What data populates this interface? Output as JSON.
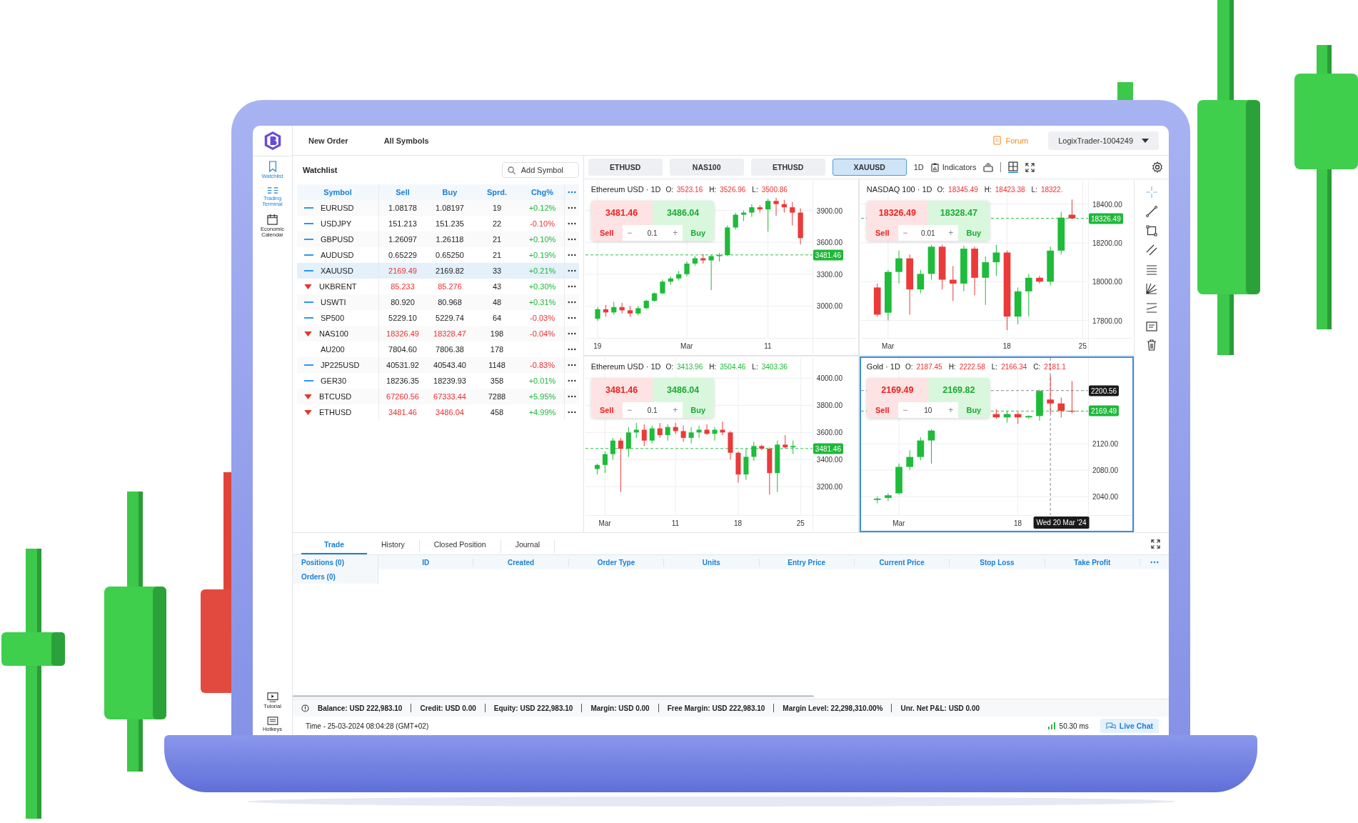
{
  "sidebar": {
    "items": [
      {
        "label": "Watchlist",
        "selected": true
      },
      {
        "label": "Trading Terminal",
        "selected": true
      },
      {
        "label": "Economic Calendar",
        "selected": false
      }
    ],
    "bottom_items": [
      {
        "label": "Tutorial"
      },
      {
        "label": "Hotkeys"
      }
    ]
  },
  "top_bar": {
    "menu": [
      "New Order",
      "All Symbols"
    ],
    "forum": "Forum",
    "account": "LogixTrader-1004249"
  },
  "watchlist": {
    "title": "Watchlist",
    "search": {
      "placeholder": "Add Symbol"
    },
    "columns": [
      "Symbol",
      "Sell",
      "Buy",
      "Sprd.",
      "Chg%"
    ],
    "rows": [
      {
        "kind": "dash",
        "symbol": "EURUSD",
        "sell": "1.08178",
        "buy": "1.08197",
        "sell_falling": false,
        "buy_falling": false,
        "spread": "19",
        "change": "+0.12%",
        "change_positive": true,
        "selected": false
      },
      {
        "kind": "dash",
        "symbol": "USDJPY",
        "sell": "151.213",
        "buy": "151.235",
        "sell_falling": false,
        "buy_falling": false,
        "spread": "22",
        "change": "-0.10%",
        "change_positive": false,
        "selected": false
      },
      {
        "kind": "dash",
        "symbol": "GBPUSD",
        "sell": "1.26097",
        "buy": "1.26118",
        "sell_falling": false,
        "buy_falling": false,
        "spread": "21",
        "change": "+0.10%",
        "change_positive": true,
        "selected": false
      },
      {
        "kind": "dash",
        "symbol": "AUDUSD",
        "sell": "0.65229",
        "buy": "0.65250",
        "sell_falling": false,
        "buy_falling": false,
        "spread": "21",
        "change": "+0.19%",
        "change_positive": true,
        "selected": false
      },
      {
        "kind": "dash",
        "symbol": "XAUUSD",
        "sell": "2169.49",
        "buy": "2169.82",
        "sell_falling": true,
        "buy_falling": false,
        "spread": "33",
        "change": "+0.21%",
        "change_positive": true,
        "selected": true
      },
      {
        "kind": "down",
        "symbol": "UKBRENT",
        "sell": "85.233",
        "buy": "85.276",
        "sell_falling": true,
        "buy_falling": true,
        "spread": "43",
        "change": "+0.30%",
        "change_positive": true,
        "selected": false
      },
      {
        "kind": "dash",
        "symbol": "USWTI",
        "sell": "80.920",
        "buy": "80.968",
        "sell_falling": false,
        "buy_falling": false,
        "spread": "48",
        "change": "+0.31%",
        "change_positive": true,
        "selected": false
      },
      {
        "kind": "dash",
        "symbol": "SP500",
        "sell": "5229.10",
        "buy": "5229.74",
        "sell_falling": false,
        "buy_falling": false,
        "spread": "64",
        "change": "-0.03%",
        "change_positive": false,
        "selected": false
      },
      {
        "kind": "down",
        "symbol": "NAS100",
        "sell": "18326.49",
        "buy": "18328.47",
        "sell_falling": true,
        "buy_falling": true,
        "spread": "198",
        "change": "-0.04%",
        "change_positive": false,
        "selected": false
      },
      {
        "kind": "none",
        "symbol": "AU200",
        "sell": "7804.60",
        "buy": "7806.38",
        "sell_falling": false,
        "buy_falling": false,
        "spread": "178",
        "selected": false
      },
      {
        "kind": "dash",
        "symbol": "JP225USD",
        "sell": "40531.92",
        "buy": "40543.40",
        "sell_falling": false,
        "buy_falling": false,
        "spread": "1148",
        "change": "-0.83%",
        "change_positive": false,
        "selected": false
      },
      {
        "kind": "dash",
        "symbol": "GER30",
        "sell": "18236.35",
        "buy": "18239.93",
        "sell_falling": false,
        "buy_falling": false,
        "spread": "358",
        "change": "+0.01%",
        "change_positive": true,
        "selected": false
      },
      {
        "kind": "down",
        "symbol": "BTCUSD",
        "sell": "67260.56",
        "buy": "67333.44",
        "sell_falling": true,
        "buy_falling": true,
        "spread": "7288",
        "change": "+5.95%",
        "change_positive": true,
        "selected": false
      },
      {
        "kind": "down",
        "symbol": "ETHUSD",
        "sell": "3481.46",
        "buy": "3486.04",
        "sell_falling": true,
        "buy_falling": true,
        "spread": "458",
        "change": "+4.99%",
        "change_positive": true,
        "selected": false
      }
    ]
  },
  "chart_tabs": [
    {
      "label": "ETHUSD",
      "selected": false
    },
    {
      "label": "NAS100",
      "selected": false
    },
    {
      "label": "ETHUSD",
      "selected": false
    },
    {
      "label": "XAUUSD",
      "selected": true
    }
  ],
  "chart_toolbar": {
    "interval": "1D",
    "indicators": "Indicators"
  },
  "charts": [
    {
      "title": "Ethereum USD · 1D",
      "falling": true,
      "ohlc_values": [
        {
          "label": "O:",
          "value": "3523.16"
        },
        {
          "label": "H:",
          "value": "3526.96"
        },
        {
          "label": "L:",
          "value": "3500.86"
        }
      ],
      "sell_price": "3481.46",
      "buy_price": "3486.04",
      "sell_label": "Sell",
      "buy_label": "Buy",
      "minus": "−",
      "plus": "+",
      "quantity": "0.1",
      "selected": false,
      "price_tags": [
        {
          "kind": "bid",
          "text": "3481.46"
        }
      ],
      "chart_data": {
        "type": "candlestick",
        "grid": true,
        "categories": [
          null,
          "19",
          null,
          null,
          null,
          null,
          null,
          null,
          null,
          null,
          null,
          null,
          "Mar",
          null,
          null,
          null,
          null,
          null,
          null,
          null,
          null,
          null,
          "11",
          null,
          null,
          null,
          null,
          null
        ],
        "ohlc": [
          null,
          [
            2880,
            2990,
            2860,
            2970
          ],
          [
            2970,
            3010,
            2900,
            2940
          ],
          [
            2940,
            3040,
            2920,
            2990
          ],
          [
            2990,
            3030,
            2930,
            2960
          ],
          [
            2960,
            3000,
            2900,
            2930
          ],
          [
            2930,
            3000,
            2910,
            2980
          ],
          [
            2980,
            3060,
            2970,
            3050
          ],
          [
            3050,
            3130,
            3040,
            3120
          ],
          [
            3120,
            3250,
            3110,
            3230
          ],
          [
            3230,
            3280,
            3200,
            3260
          ],
          [
            3260,
            3330,
            3240,
            3300
          ],
          [
            3300,
            3420,
            3280,
            3400
          ],
          [
            3400,
            3470,
            3380,
            3450
          ],
          [
            3450,
            3490,
            3400,
            3430
          ],
          [
            3430,
            3480,
            3150,
            3470
          ],
          [
            3470,
            3500,
            3420,
            3480
          ],
          [
            3480,
            3760,
            3470,
            3740
          ],
          [
            3740,
            3880,
            3720,
            3860
          ],
          [
            3860,
            3900,
            3800,
            3880
          ],
          [
            3880,
            3960,
            3840,
            3930
          ],
          [
            3930,
            3950,
            3880,
            3910
          ],
          [
            3910,
            4010,
            3700,
            3990
          ],
          [
            3990,
            4020,
            3850,
            3960
          ],
          [
            3960,
            4000,
            3880,
            3930
          ],
          [
            3930,
            3980,
            3760,
            3880
          ],
          [
            3880,
            3920,
            3580,
            3640
          ],
          null
        ],
        "ylim": [
          2700,
          4180
        ],
        "yticks": [
          {
            "value": 3900,
            "label": "3900.00"
          },
          {
            "value": 3600,
            "label": "3600.00"
          },
          {
            "value": 3300,
            "label": "3300.00"
          },
          {
            "value": 3000,
            "label": "3000.00"
          }
        ],
        "ref_lines": [
          {
            "axis": "y",
            "value": 3481.46
          }
        ]
      }
    },
    {
      "title": "NASDAQ 100 · 1D",
      "falling": true,
      "ohlc_values": [
        {
          "label": "O:",
          "value": "18345.49"
        },
        {
          "label": "H:",
          "value": "18423.38"
        },
        {
          "label": "L:",
          "value": "18322."
        }
      ],
      "sell_price": "18326.49",
      "buy_price": "18328.47",
      "sell_label": "Sell",
      "buy_label": "Buy",
      "minus": "−",
      "plus": "+",
      "quantity": "0.01",
      "selected": false,
      "price_tags": [
        {
          "kind": "bid",
          "text": "18326.49"
        }
      ],
      "chart_data": {
        "type": "candlestick",
        "grid": true,
        "categories": [
          null,
          null,
          "Mar",
          null,
          null,
          null,
          null,
          null,
          null,
          null,
          null,
          null,
          null,
          "18",
          null,
          null,
          null,
          null,
          null,
          null,
          "25"
        ],
        "ohlc": [
          null,
          [
            17970,
            17990,
            17820,
            17830
          ],
          [
            17840,
            18060,
            17800,
            18050
          ],
          [
            18050,
            18160,
            17990,
            18120
          ],
          [
            18120,
            18140,
            17830,
            17960
          ],
          [
            17960,
            18060,
            17940,
            18040
          ],
          [
            18040,
            18190,
            18010,
            18180
          ],
          [
            18180,
            18190,
            17960,
            18010
          ],
          [
            18010,
            18080,
            17900,
            17990
          ],
          [
            17990,
            18185,
            17950,
            18170
          ],
          [
            18170,
            18180,
            17930,
            18020
          ],
          [
            18020,
            18130,
            17880,
            18100
          ],
          [
            18100,
            18190,
            18030,
            18150
          ],
          [
            18150,
            18160,
            17750,
            17820
          ],
          [
            17820,
            17970,
            17780,
            17950
          ],
          [
            17950,
            18040,
            17820,
            18020
          ],
          [
            18020,
            18030,
            17990,
            18000
          ],
          [
            18000,
            18180,
            17980,
            18160
          ],
          [
            18160,
            18360,
            18140,
            18330
          ],
          [
            18345,
            18423,
            18322,
            18326
          ],
          null
        ],
        "ylim": [
          17710,
          18520
        ],
        "yticks": [
          {
            "value": 18400,
            "label": "18400.00"
          },
          {
            "value": 18200,
            "label": "18200.00"
          },
          {
            "value": 18000,
            "label": "18000.00"
          },
          {
            "value": 17800,
            "label": "17800.00"
          }
        ],
        "ref_lines": [
          {
            "axis": "y",
            "value": 18326.49
          }
        ]
      }
    },
    {
      "title": "Ethereum USD · 1D",
      "falling": false,
      "ohlc_values": [
        {
          "label": "O:",
          "value": "3413.96"
        },
        {
          "label": "H:",
          "value": "3504.46"
        },
        {
          "label": "L:",
          "value": "3403.36"
        }
      ],
      "sell_price": "3481.46",
      "buy_price": "3486.04",
      "sell_label": "Sell",
      "buy_label": "Buy",
      "minus": "−",
      "plus": "+",
      "quantity": "0.1",
      "selected": false,
      "price_tags": [
        {
          "kind": "bid",
          "text": "3481.46"
        }
      ],
      "chart_data": {
        "type": "candlestick",
        "grid": true,
        "categories": [
          null,
          null,
          "Mar",
          null,
          null,
          null,
          null,
          null,
          null,
          null,
          null,
          "11",
          null,
          null,
          null,
          null,
          null,
          null,
          null,
          "18",
          null,
          null,
          null,
          null,
          null,
          null,
          null,
          "25",
          null
        ],
        "ohlc": [
          null,
          [
            3330,
            3370,
            3290,
            3360
          ],
          [
            3360,
            3460,
            3300,
            3440
          ],
          [
            3440,
            3560,
            3400,
            3540
          ],
          [
            3540,
            3560,
            3160,
            3480
          ],
          [
            3480,
            3640,
            3420,
            3600
          ],
          [
            3600,
            3670,
            3560,
            3620
          ],
          [
            3620,
            3660,
            3500,
            3540
          ],
          [
            3540,
            3650,
            3520,
            3630
          ],
          [
            3630,
            3670,
            3560,
            3580
          ],
          [
            3580,
            3660,
            3540,
            3640
          ],
          [
            3640,
            3670,
            3590,
            3610
          ],
          [
            3610,
            3650,
            3530,
            3560
          ],
          [
            3560,
            3640,
            3520,
            3600
          ],
          [
            3600,
            3650,
            3560,
            3620
          ],
          [
            3620,
            3660,
            3580,
            3590
          ],
          [
            3590,
            3640,
            3540,
            3620
          ],
          [
            3620,
            3680,
            3580,
            3600
          ],
          [
            3600,
            3610,
            3400,
            3450
          ],
          [
            3450,
            3460,
            3230,
            3290
          ],
          [
            3290,
            3480,
            3250,
            3420
          ],
          [
            3420,
            3530,
            3390,
            3500
          ],
          [
            3500,
            3510,
            3470,
            3480
          ],
          [
            3480,
            3490,
            3140,
            3300
          ],
          [
            3300,
            3540,
            3160,
            3510
          ],
          [
            3510,
            3580,
            3480,
            3490
          ],
          [
            3490,
            3540,
            3440,
            3500
          ],
          null,
          null
        ],
        "ylim": [
          2990,
          4150
        ],
        "yticks": [
          {
            "value": 4000,
            "label": "4000.00"
          },
          {
            "value": 3800,
            "label": "3800.00"
          },
          {
            "value": 3600,
            "label": "3600.00"
          },
          {
            "value": 3400,
            "label": "3400.00"
          },
          {
            "value": 3200,
            "label": "3200.00"
          }
        ],
        "ref_lines": [
          {
            "axis": "y",
            "value": 3481.46
          }
        ]
      }
    },
    {
      "title": "Gold · 1D",
      "falling": true,
      "ohlc_values": [
        {
          "label": "O:",
          "value": "2187.45"
        },
        {
          "label": "H:",
          "value": "2222.58"
        },
        {
          "label": "L:",
          "value": "2166.34"
        },
        {
          "label": "C:",
          "value": "2181.1"
        }
      ],
      "sell_price": "2169.49",
      "buy_price": "2169.82",
      "sell_label": "Sell",
      "buy_label": "Buy",
      "minus": "−",
      "plus": "+",
      "quantity": "10",
      "selected": true,
      "crosshair_date": "Wed 20 Mar '24",
      "price_tags": [
        {
          "kind": "crosshair",
          "text": "2200.56"
        },
        {
          "kind": "bid",
          "text": "2169.49"
        }
      ],
      "chart_data": {
        "type": "candlestick",
        "grid": true,
        "categories": [
          null,
          null,
          null,
          "Mar",
          null,
          null,
          null,
          null,
          null,
          null,
          null,
          null,
          null,
          null,
          "18",
          null,
          null,
          null,
          null,
          null,
          null
        ],
        "ohlc": [
          null,
          [
            2035,
            2040,
            2030,
            2037
          ],
          [
            2038,
            2045,
            2033,
            2042
          ],
          [
            2045,
            2090,
            2043,
            2085
          ],
          [
            2085,
            2110,
            2080,
            2100
          ],
          [
            2100,
            2130,
            2095,
            2125
          ],
          [
            2125,
            2142,
            2090,
            2140
          ],
          null,
          null,
          null,
          null,
          null,
          [
            2165,
            2172,
            2158,
            2160
          ],
          [
            2160,
            2170,
            2152,
            2165
          ],
          [
            2165,
            2168,
            2150,
            2160
          ],
          [
            2160,
            2163,
            2158,
            2162
          ],
          [
            2162,
            2202,
            2155,
            2200
          ],
          [
            2187,
            2223,
            2166,
            2181
          ],
          [
            2181,
            2190,
            2160,
            2170
          ],
          [
            2170,
            2215,
            2166,
            2169
          ],
          null
        ],
        "ylim": [
          2012,
          2250
        ],
        "yticks": [
          {
            "value": 2120,
            "label": "2120.00"
          },
          {
            "value": 2080,
            "label": "2080.00"
          },
          {
            "value": 2040,
            "label": "2040.00"
          }
        ],
        "ref_lines": [
          {
            "axis": "y",
            "value": 2200.56
          },
          {
            "axis": "y",
            "value": 2169.49
          }
        ]
      }
    }
  ],
  "bottom_panel": {
    "tabs": [
      {
        "label": "Trade",
        "selected": true
      },
      {
        "label": "History",
        "selected": false
      },
      {
        "label": "Closed Position",
        "selected": false
      },
      {
        "label": "Journal",
        "selected": false
      }
    ],
    "side": [
      "Positions (0)",
      "Orders (0)"
    ],
    "columns": [
      "ID",
      "Created",
      "Order Type",
      "Units",
      "Entry Price",
      "Current Price",
      "Stop Loss",
      "Take Profit"
    ]
  },
  "account_bar": [
    "Balance: USD 222,983.10",
    "Credit: USD 0.00",
    "Equity: USD 222,983.10",
    "Margin: USD 0.00",
    "Free Margin: USD 222,983.10",
    "Margin Level:  22,298,310.00%",
    "Unr. Net P&L: USD 0.00"
  ],
  "status_bar": {
    "time": "Time - 25-03-2024 08:04:28 (GMT+02)",
    "latency": "50.30 ms",
    "live_chat": "Live Chat"
  }
}
